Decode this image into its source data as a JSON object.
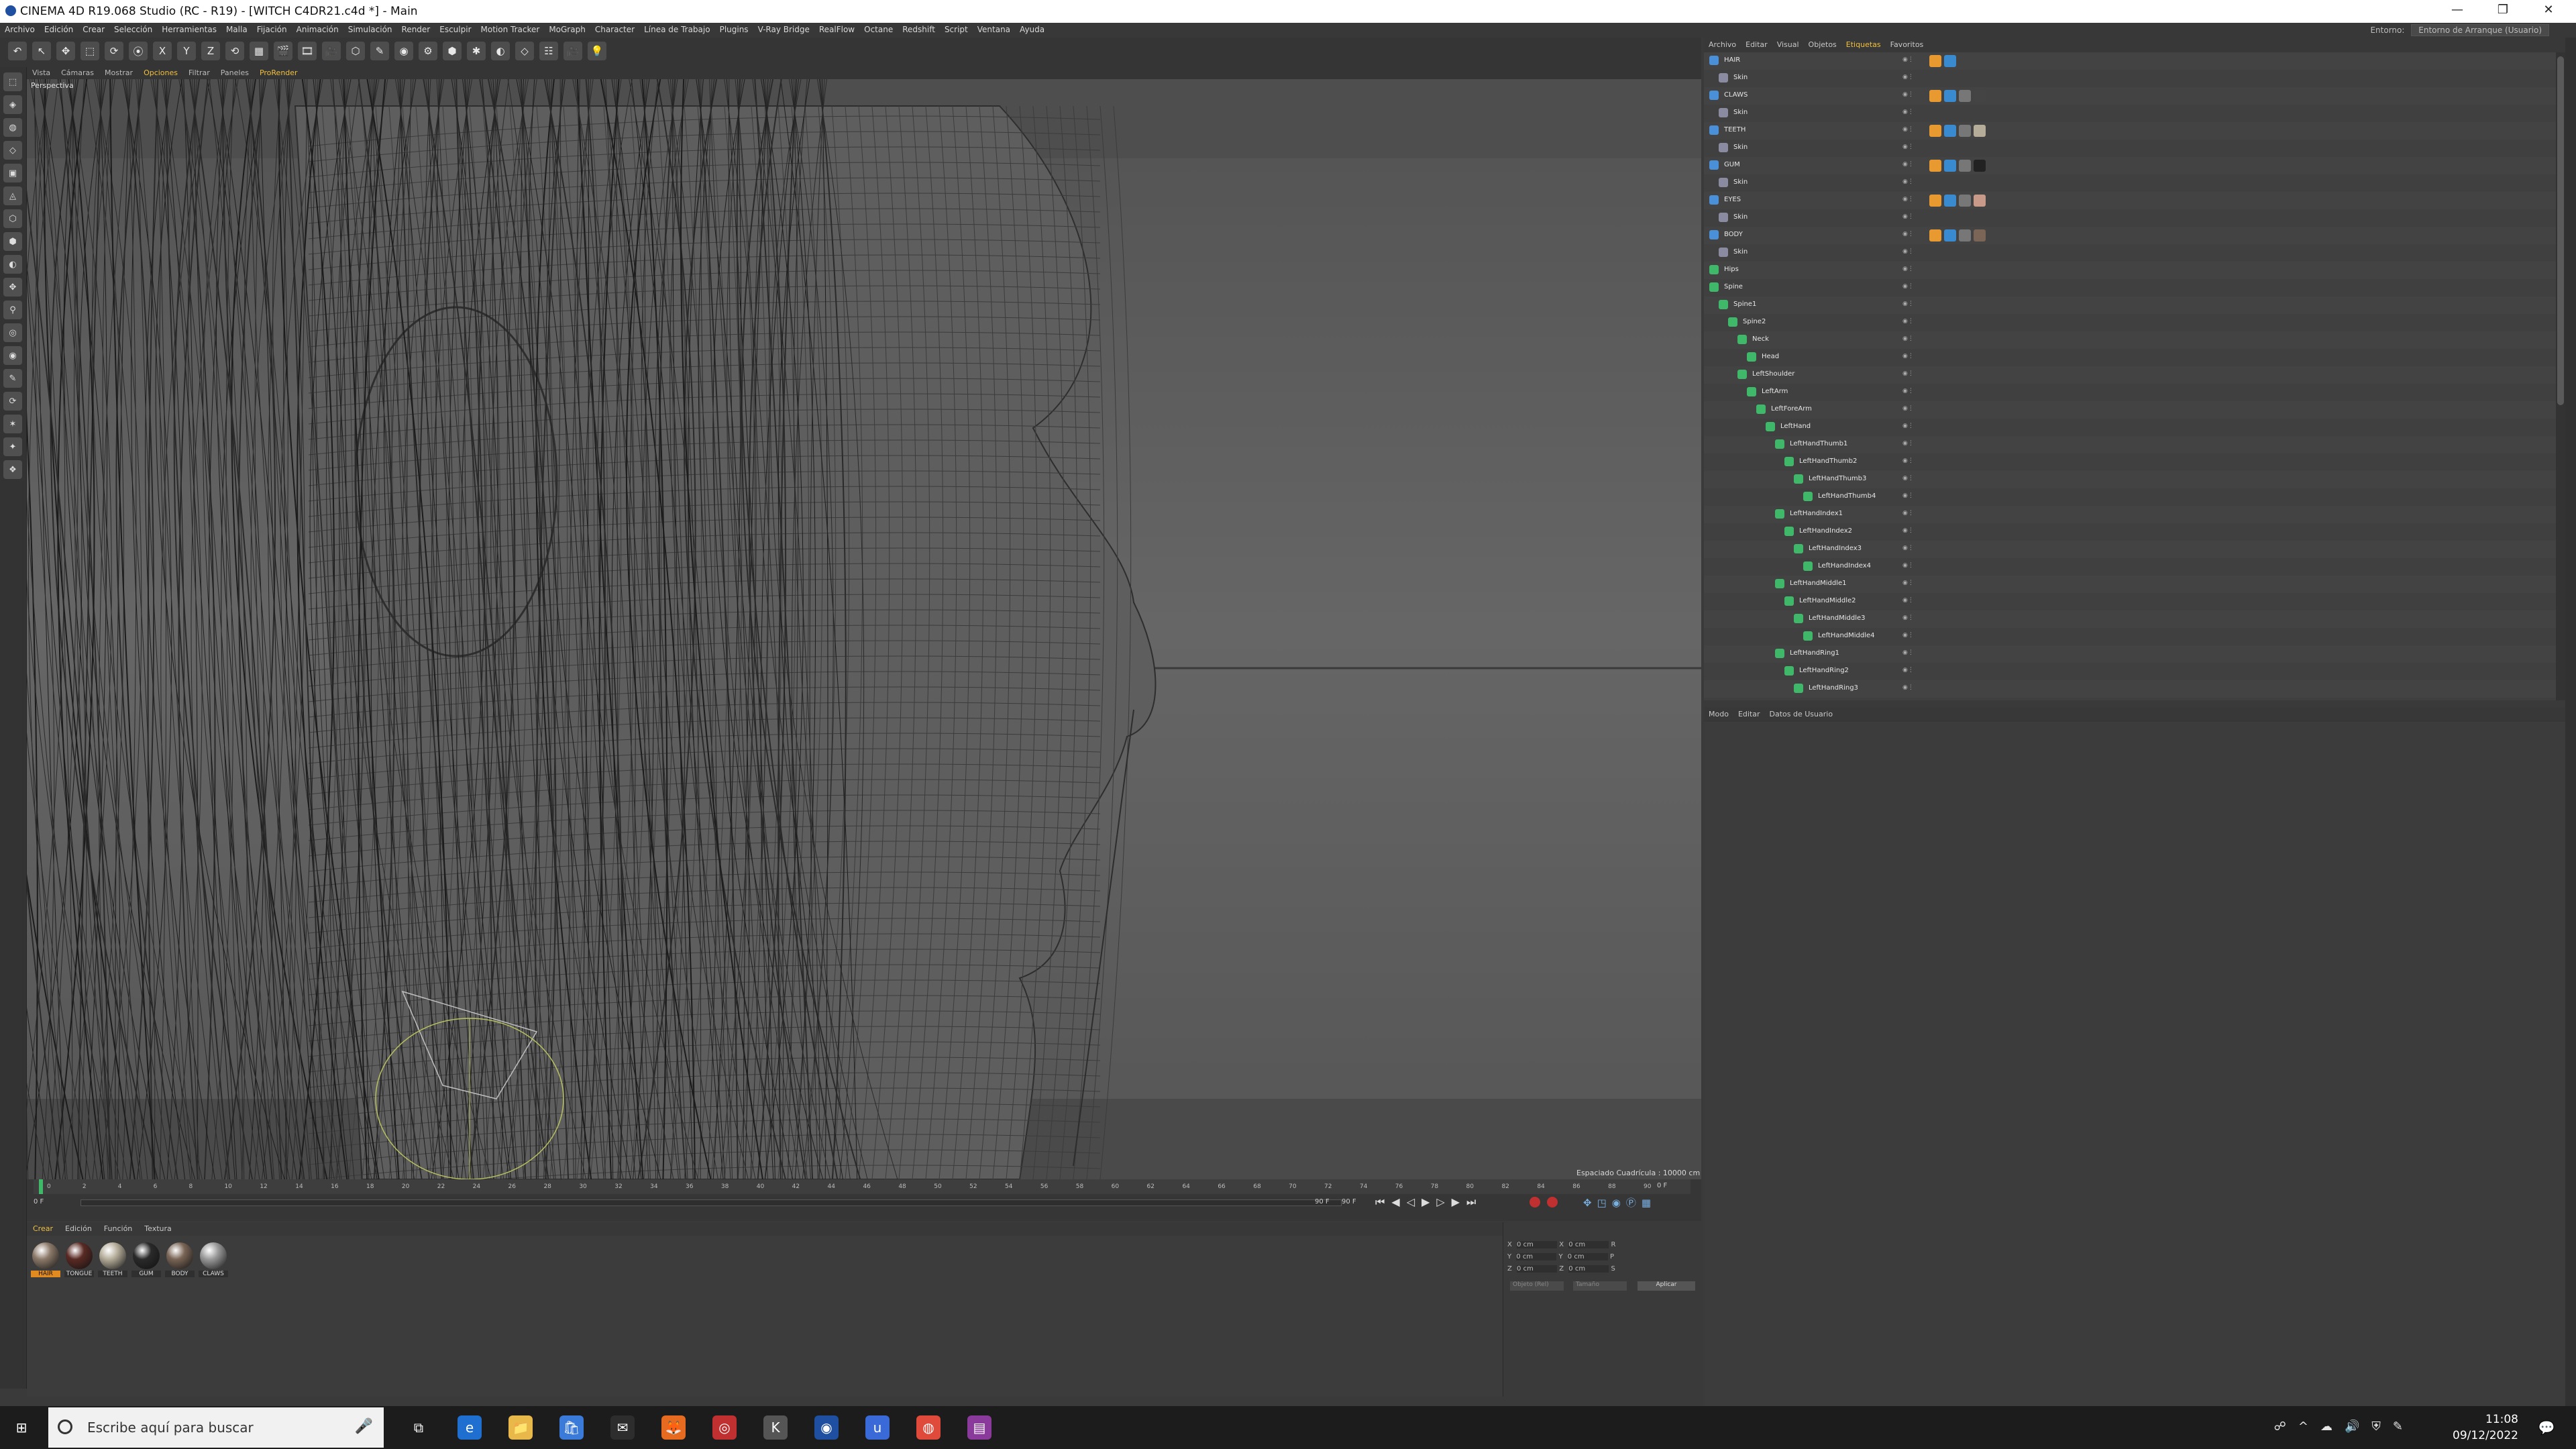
{
  "window": {
    "title": "CINEMA 4D R19.068 Studio (RC - R19) - [WITCH C4DR21.c4d *] - Main",
    "minimize": "—",
    "restore": "❐",
    "close": "✕"
  },
  "menubar": {
    "items": [
      "Archivo",
      "Edición",
      "Crear",
      "Selección",
      "Herramientas",
      "Malla",
      "Fijación",
      "Animación",
      "Simulación",
      "Render",
      "Esculpir",
      "Motion Tracker",
      "MoGraph",
      "Character",
      "Línea de Trabajo",
      "Plugins",
      "V-Ray Bridge",
      "RealFlow",
      "Octane",
      "Redshift",
      "Script",
      "Ventana",
      "Ayuda"
    ],
    "layout_label": "Entorno:",
    "layout_value": "Entorno de Arranque (Usuario)"
  },
  "toolbar": {
    "buttons": [
      "↶",
      "↖",
      "✥",
      "⬚",
      "⟳",
      "⦿",
      "X",
      "Y",
      "Z",
      "⟲",
      "▦",
      "🎬",
      "🎞",
      "🎥",
      "⬡",
      "✎",
      "◉",
      "⚙",
      "⬢",
      "✱",
      "◐",
      "◇",
      "☷",
      "🎥",
      "💡"
    ]
  },
  "viewport": {
    "menu": [
      "Vista",
      "Cámaras",
      "Mostrar",
      "Opciones",
      "Filtrar",
      "Paneles",
      "ProRender"
    ],
    "menu_highlight": "Opciones",
    "label": "Perspectiva",
    "status": "Espaciado Cuadrícula : 10000 cm"
  },
  "timeline": {
    "ticks": [
      "0",
      "2",
      "4",
      "6",
      "8",
      "10",
      "12",
      "14",
      "16",
      "18",
      "20",
      "22",
      "24",
      "26",
      "28",
      "30",
      "32",
      "34",
      "36",
      "38",
      "40",
      "42",
      "44",
      "46",
      "48",
      "50",
      "52",
      "54",
      "56",
      "58",
      "60",
      "62",
      "64",
      "66",
      "68",
      "70",
      "72",
      "74",
      "76",
      "78",
      "80",
      "82",
      "84",
      "86",
      "88",
      "90"
    ],
    "current": "0 F",
    "start": "0 F",
    "end": "90 F",
    "end2": "90 F"
  },
  "materials": {
    "menu": [
      "Crear",
      "Edición",
      "Función",
      "Textura"
    ],
    "items": [
      {
        "label": "HAIR",
        "color": "#8c7a6a"
      },
      {
        "label": "TONGUE",
        "color": "#5a2a24"
      },
      {
        "label": "TEETH",
        "color": "#b5ad9a"
      },
      {
        "label": "GUM",
        "color": "#2a2a2a"
      },
      {
        "label": "BODY",
        "color": "#7a6556"
      },
      {
        "label": "CLAWS",
        "color": "#9a9a9a"
      }
    ]
  },
  "coords": {
    "rows": [
      "X",
      "Y",
      "Z"
    ],
    "cols": [
      "P",
      "S",
      "R"
    ],
    "value": "0 cm",
    "size_value": "0 cm",
    "angle_value": "0 °",
    "mode1": "Objeto (Rel)",
    "mode2": "Tamaño",
    "apply": "Aplicar"
  },
  "object_manager": {
    "menu": [
      "Archivo",
      "Editar",
      "Visual",
      "Objetos",
      "Etiquetas",
      "Favoritos"
    ],
    "menu_highlight": "Etiquetas",
    "rows": [
      {
        "name": "HAIR",
        "indent": 0,
        "type": "mesh",
        "tags": [
          "#e89a30",
          "#3a8ad0"
        ]
      },
      {
        "name": "Skin",
        "indent": 1,
        "type": "skin",
        "tags": []
      },
      {
        "name": "CLAWS",
        "indent": 0,
        "type": "mesh",
        "tags": [
          "#e89a30",
          "#3a8ad0",
          "#777",
          "#444"
        ]
      },
      {
        "name": "Skin",
        "indent": 1,
        "type": "skin",
        "tags": []
      },
      {
        "name": "TEETH",
        "indent": 0,
        "type": "mesh",
        "tags": [
          "#e89a30",
          "#3a8ad0",
          "#777",
          "#b5ad9a"
        ]
      },
      {
        "name": "Skin",
        "indent": 1,
        "type": "skin",
        "tags": []
      },
      {
        "name": "GUM",
        "indent": 0,
        "type": "mesh",
        "tags": [
          "#e89a30",
          "#3a8ad0",
          "#777",
          "#222"
        ]
      },
      {
        "name": "Skin",
        "indent": 1,
        "type": "skin",
        "tags": []
      },
      {
        "name": "EYES",
        "indent": 0,
        "type": "mesh",
        "tags": [
          "#e89a30",
          "#3a8ad0",
          "#777",
          "#c89a8a"
        ]
      },
      {
        "name": "Skin",
        "indent": 1,
        "type": "skin",
        "tags": []
      },
      {
        "name": "BODY",
        "indent": 0,
        "type": "mesh",
        "tags": [
          "#e89a30",
          "#3a8ad0",
          "#777",
          "#7a6556"
        ]
      },
      {
        "name": "Skin",
        "indent": 1,
        "type": "skin",
        "tags": []
      },
      {
        "name": "Hips",
        "indent": 0,
        "type": "joint",
        "tags": []
      },
      {
        "name": "Spine",
        "indent": 0,
        "type": "joint",
        "tags": []
      },
      {
        "name": "Spine1",
        "indent": 1,
        "type": "joint",
        "tags": []
      },
      {
        "name": "Spine2",
        "indent": 2,
        "type": "joint",
        "tags": []
      },
      {
        "name": "Neck",
        "indent": 3,
        "type": "joint",
        "tags": []
      },
      {
        "name": "Head",
        "indent": 4,
        "type": "joint",
        "tags": []
      },
      {
        "name": "LeftShoulder",
        "indent": 3,
        "type": "joint",
        "tags": []
      },
      {
        "name": "LeftArm",
        "indent": 4,
        "type": "joint",
        "tags": []
      },
      {
        "name": "LeftForeArm",
        "indent": 5,
        "type": "joint",
        "tags": []
      },
      {
        "name": "LeftHand",
        "indent": 6,
        "type": "joint",
        "tags": []
      },
      {
        "name": "LeftHandThumb1",
        "indent": 7,
        "type": "joint",
        "tags": []
      },
      {
        "name": "LeftHandThumb2",
        "indent": 8,
        "type": "joint",
        "tags": []
      },
      {
        "name": "LeftHandThumb3",
        "indent": 9,
        "type": "joint",
        "tags": []
      },
      {
        "name": "LeftHandThumb4",
        "indent": 10,
        "type": "joint",
        "tags": []
      },
      {
        "name": "LeftHandIndex1",
        "indent": 7,
        "type": "joint",
        "tags": []
      },
      {
        "name": "LeftHandIndex2",
        "indent": 8,
        "type": "joint",
        "tags": []
      },
      {
        "name": "LeftHandIndex3",
        "indent": 9,
        "type": "joint",
        "tags": []
      },
      {
        "name": "LeftHandIndex4",
        "indent": 10,
        "type": "joint",
        "tags": []
      },
      {
        "name": "LeftHandMiddle1",
        "indent": 7,
        "type": "joint",
        "tags": []
      },
      {
        "name": "LeftHandMiddle2",
        "indent": 8,
        "type": "joint",
        "tags": []
      },
      {
        "name": "LeftHandMiddle3",
        "indent": 9,
        "type": "joint",
        "tags": []
      },
      {
        "name": "LeftHandMiddle4",
        "indent": 10,
        "type": "joint",
        "tags": []
      },
      {
        "name": "LeftHandRing1",
        "indent": 7,
        "type": "joint",
        "tags": []
      },
      {
        "name": "LeftHandRing2",
        "indent": 8,
        "type": "joint",
        "tags": []
      },
      {
        "name": "LeftHandRing3",
        "indent": 9,
        "type": "joint",
        "tags": []
      }
    ]
  },
  "attribute_manager": {
    "menu": [
      "Modo",
      "Editar",
      "Datos de Usuario"
    ]
  },
  "taskbar": {
    "search_placeholder": "Escribe aquí para buscar",
    "apps": [
      "edge",
      "explorer",
      "store",
      "mail",
      "firefox",
      "app",
      "k",
      "cinema4d",
      "app2",
      "chrome",
      "winrar"
    ],
    "time": "11:08",
    "date": "09/12/2022"
  },
  "colors": {
    "accent_highlight": "#f0c040",
    "joint_green": "#3fb86a",
    "mesh_blue": "#4a90d9"
  }
}
